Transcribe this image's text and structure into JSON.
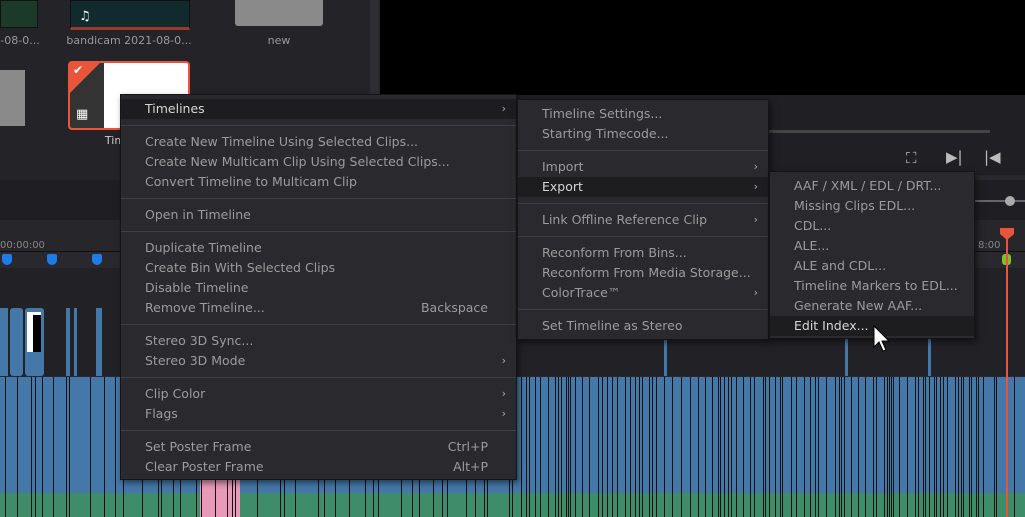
{
  "bin": {
    "clips": [
      {
        "label": "-08-0..."
      },
      {
        "label": "bandicam 2021-08-0..."
      },
      {
        "label": "new"
      },
      {
        "label": "Tim"
      }
    ]
  },
  "timeline": {
    "start_timecode": "00:00:00",
    "end_timecode": "8:00"
  },
  "colors": {
    "accent": "#e8553a",
    "video_track": "#4478a8",
    "audio_track": "#3f8c68",
    "pink_clip": "#e89ab8",
    "marker": "#1e7ce8"
  },
  "viewer": {
    "icons": [
      "loop-icon",
      "next-frame-icon",
      "prev-frame-icon"
    ]
  },
  "menu_main": [
    {
      "label": "Timelines",
      "submenu": true,
      "highlight": true
    },
    {
      "sep": true
    },
    {
      "label": "Create New Timeline Using Selected Clips..."
    },
    {
      "label": "Create New Multicam Clip Using Selected Clips..."
    },
    {
      "label": "Convert Timeline to Multicam Clip"
    },
    {
      "sep": true
    },
    {
      "label": "Open in Timeline"
    },
    {
      "sep": true
    },
    {
      "label": "Duplicate Timeline"
    },
    {
      "label": "Create Bin With Selected Clips"
    },
    {
      "label": "Disable Timeline"
    },
    {
      "label": "Remove Timeline...",
      "shortcut": "Backspace"
    },
    {
      "sep": true
    },
    {
      "label": "Stereo 3D Sync..."
    },
    {
      "label": "Stereo 3D Mode",
      "submenu": true
    },
    {
      "sep": true
    },
    {
      "label": "Clip Color",
      "submenu": true
    },
    {
      "label": "Flags",
      "submenu": true
    },
    {
      "sep": true
    },
    {
      "label": "Set Poster Frame",
      "shortcut": "Ctrl+P"
    },
    {
      "label": "Clear Poster Frame",
      "shortcut": "Alt+P"
    }
  ],
  "menu_timelines": [
    {
      "label": "Timeline Settings..."
    },
    {
      "label": "Starting Timecode..."
    },
    {
      "sep": true
    },
    {
      "label": "Import",
      "submenu": true
    },
    {
      "label": "Export",
      "submenu": true,
      "highlight": true
    },
    {
      "sep": true
    },
    {
      "label": "Link Offline Reference Clip",
      "submenu": true
    },
    {
      "sep": true
    },
    {
      "label": "Reconform From Bins..."
    },
    {
      "label": "Reconform From Media Storage..."
    },
    {
      "label": "ColorTrace™",
      "submenu": true
    },
    {
      "sep": true
    },
    {
      "label": "Set Timeline as Stereo"
    }
  ],
  "menu_export": [
    {
      "label": "AAF / XML / EDL / DRT..."
    },
    {
      "label": "Missing Clips EDL..."
    },
    {
      "label": "CDL..."
    },
    {
      "label": "ALE..."
    },
    {
      "label": "ALE and CDL..."
    },
    {
      "label": "Timeline Markers to EDL..."
    },
    {
      "label": "Generate New AAF..."
    },
    {
      "label": "Edit Index...",
      "highlight": true
    }
  ]
}
